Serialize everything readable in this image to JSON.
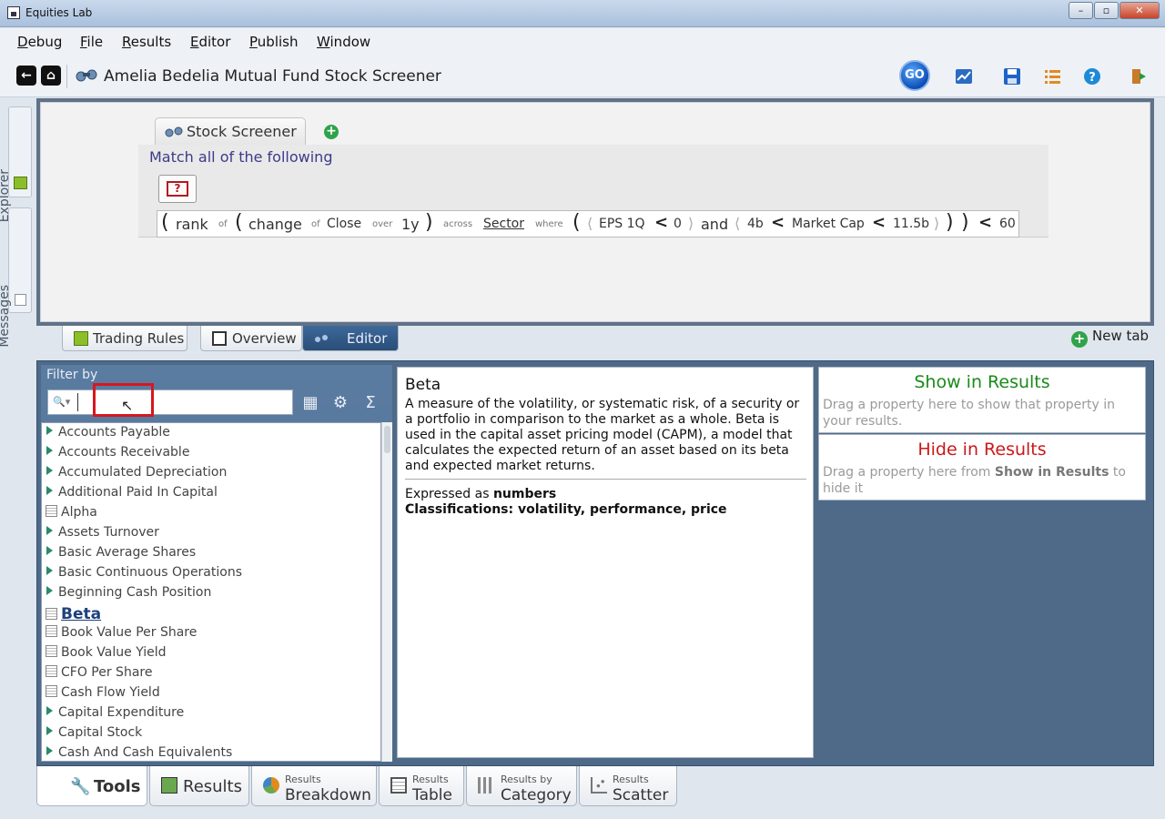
{
  "window": {
    "title": "Equities Lab",
    "min": "–",
    "max": "▫",
    "close": "✕"
  },
  "menu": [
    "Debug",
    "File",
    "Results",
    "Editor",
    "Publish",
    "Window"
  ],
  "toolbar": {
    "title": "Amelia Bedelia Mutual Fund Stock Screener",
    "go_label": "GO"
  },
  "side_tabs": {
    "explorer": "Explorer",
    "messages": "Messages"
  },
  "editor": {
    "tab_label": "Stock Screener",
    "match_text": "Match all of the following",
    "help_label": "?",
    "expression": {
      "open1": "(",
      "rank": "rank",
      "of1": "of",
      "open2": "(",
      "change": "change",
      "of2": "of",
      "close_word": "Close",
      "over": "over",
      "period": "1y",
      "close2": ")",
      "across": "across",
      "sector": "Sector",
      "where": "where",
      "open3": "(",
      "eps": "EPS 1Q",
      "lt1": "<",
      "zero": "0",
      "and": "and",
      "low": "4b",
      "lt2": "<",
      "mcap": "Market Cap",
      "lt3": "<",
      "high": "11.5b",
      "close3": ")",
      "close4": ")",
      "lt4": "<",
      "limit": "60"
    }
  },
  "lower_tabs": {
    "trading_rules": "Trading Rules",
    "overview": "Overview",
    "editor": "Editor",
    "new_tab": "New tab"
  },
  "filter": {
    "label": "Filter by",
    "search_value": "",
    "search_placeholder": "",
    "properties": [
      {
        "name": "Accounts Payable",
        "kind": "tri"
      },
      {
        "name": "Accounts Receivable",
        "kind": "tri"
      },
      {
        "name": "Accumulated Depreciation",
        "kind": "tri"
      },
      {
        "name": "Additional Paid In Capital",
        "kind": "tri"
      },
      {
        "name": "Alpha",
        "kind": "doc"
      },
      {
        "name": "Assets Turnover",
        "kind": "tri"
      },
      {
        "name": "Basic Average Shares",
        "kind": "tri"
      },
      {
        "name": "Basic Continuous Operations",
        "kind": "tri"
      },
      {
        "name": "Beginning Cash Position",
        "kind": "tri"
      },
      {
        "name": "Beta",
        "kind": "doc",
        "selected": true
      },
      {
        "name": "Book Value Per Share",
        "kind": "doc"
      },
      {
        "name": "Book Value Yield",
        "kind": "doc"
      },
      {
        "name": "CFO Per Share",
        "kind": "doc"
      },
      {
        "name": "Cash Flow Yield",
        "kind": "doc"
      },
      {
        "name": "Capital Expenditure",
        "kind": "tri"
      },
      {
        "name": "Capital Stock",
        "kind": "tri"
      },
      {
        "name": "Cash And Cash Equivalents",
        "kind": "tri"
      }
    ]
  },
  "description": {
    "title": "Beta",
    "text": "A measure of the volatility, or systematic risk, of a security or a portfolio in comparison to the market as a whole. Beta is used in the capital asset pricing model (CAPM), a model that calculates the expected return of an asset based on its beta and expected market returns.",
    "expressed_prefix": "Expressed as ",
    "expressed_value": "numbers",
    "class_prefix": "Classifications: ",
    "class_value": "volatility, performance, price"
  },
  "show_results": {
    "heading": "Show in Results",
    "color": "#1a8a1a",
    "text": "Drag a property here to show that property in your results."
  },
  "hide_results": {
    "heading": "Hide in Results",
    "color": "#cc1818",
    "text_a": "Drag a property here from ",
    "text_b": "Show in Results",
    "text_c": " to hide it"
  },
  "bottom_tabs": {
    "tools": "Tools",
    "results": "Results",
    "breakdown_sm": "Results",
    "breakdown_big": "Breakdown",
    "table_sm": "Results",
    "table_big": "Table",
    "category_sm": "Results by",
    "category_big": "Category",
    "scatter_sm": "Results",
    "scatter_big": "Scatter"
  }
}
